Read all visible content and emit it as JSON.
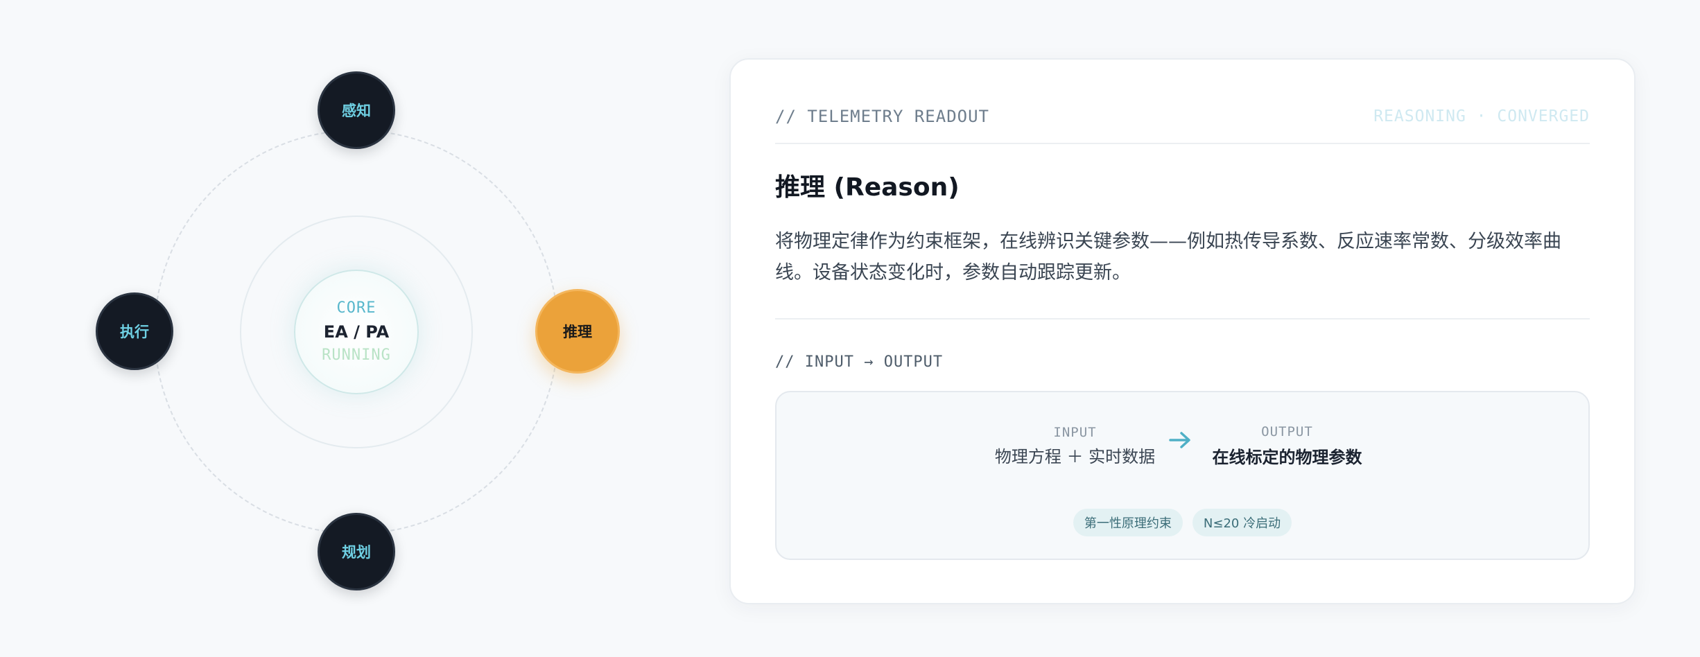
{
  "orbit": {
    "core": {
      "label": "CORE",
      "name": "EA / PA",
      "status": "RUNNING"
    },
    "nodes": {
      "top": "感知",
      "left": "执行",
      "bottom": "规划",
      "right": "推理"
    },
    "active_node": "推理"
  },
  "card": {
    "eyebrow": "// TELEMETRY READOUT",
    "state": "REASONING · CONVERGED",
    "title": "推理 (Reason)",
    "description": "将物理定律作为约束框架，在线辨识关键参数——例如热传导系数、反应速率常数、分级效率曲线。设备状态变化时，参数自动跟踪更新。",
    "io_heading": "// INPUT → OUTPUT",
    "io": {
      "input_label": "INPUT",
      "input_value": "物理方程 ＋ 实时数据",
      "output_label": "OUTPUT",
      "output_value": "在线标定的物理参数",
      "arrow_icon": "arrow-right-icon",
      "tags": [
        "第一性原理约束",
        "N≤20 冷启动"
      ]
    }
  },
  "colors": {
    "accent": "#eba23a",
    "node_dark": "#141a24",
    "node_text": "#6fd0e3",
    "core_label": "#58b7cc",
    "core_status": "#b9e3c6",
    "tag_bg": "#e3f1f3"
  }
}
